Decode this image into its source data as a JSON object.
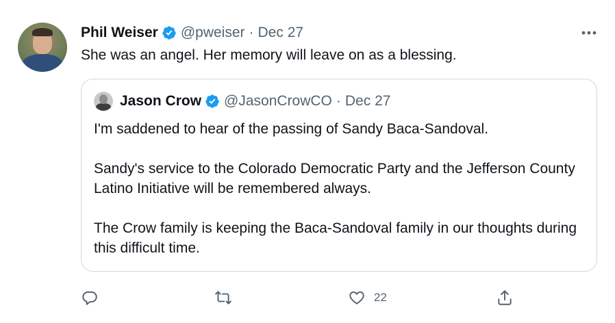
{
  "tweet": {
    "author_name": "Phil Weiser",
    "handle": "@pweiser",
    "separator": "·",
    "date": "Dec 27",
    "text": "She was an angel.  Her memory will leave on as a blessing."
  },
  "quoted_tweet": {
    "author_name": "Jason Crow",
    "handle": "@JasonCrowCO",
    "separator": "·",
    "date": "Dec 27",
    "paragraphs": [
      "I'm saddened to hear of the passing of Sandy Baca-Sandoval.",
      "Sandy's service to the Colorado Democratic Party and the Jefferson County Latino Initiative will be remembered always.",
      "The Crow family is keeping the Baca-Sandoval family in our thoughts during this difficult time."
    ]
  },
  "actions": {
    "reply_icon": "reply-icon",
    "retweet_icon": "retweet-icon",
    "like_icon": "heart-icon",
    "like_count": "22",
    "share_icon": "share-icon"
  },
  "colors": {
    "verified": "#1d9bf0",
    "secondary_text": "#536471",
    "primary_text": "#0f1419",
    "border": "#cfd9de"
  }
}
